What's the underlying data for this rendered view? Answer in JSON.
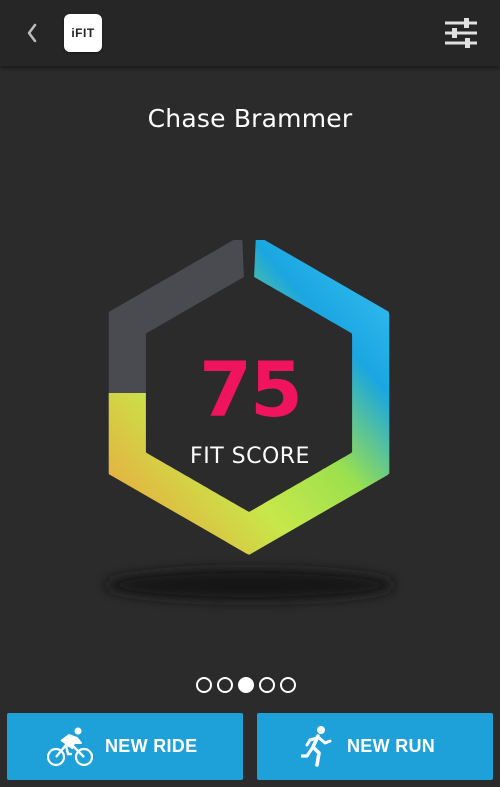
{
  "header": {
    "logo_text": "iFIT",
    "back_icon": "chevron-left-icon",
    "settings_icon": "sliders-icon"
  },
  "profile": {
    "name": "Chase Brammer"
  },
  "score": {
    "value": "75",
    "label": "FIT SCORE",
    "fraction": 0.75,
    "gradient": [
      "#f4983a",
      "#c7e84a",
      "#9be04e",
      "#1aa6e0",
      "#3ec5f7"
    ],
    "track_color": "#4a4b50",
    "value_color": "#f0135e"
  },
  "pager": {
    "count": 5,
    "active_index": 2
  },
  "actions": {
    "ride_label": "NEW RIDE",
    "run_label": "NEW RUN",
    "button_color": "#1ea0d8"
  }
}
